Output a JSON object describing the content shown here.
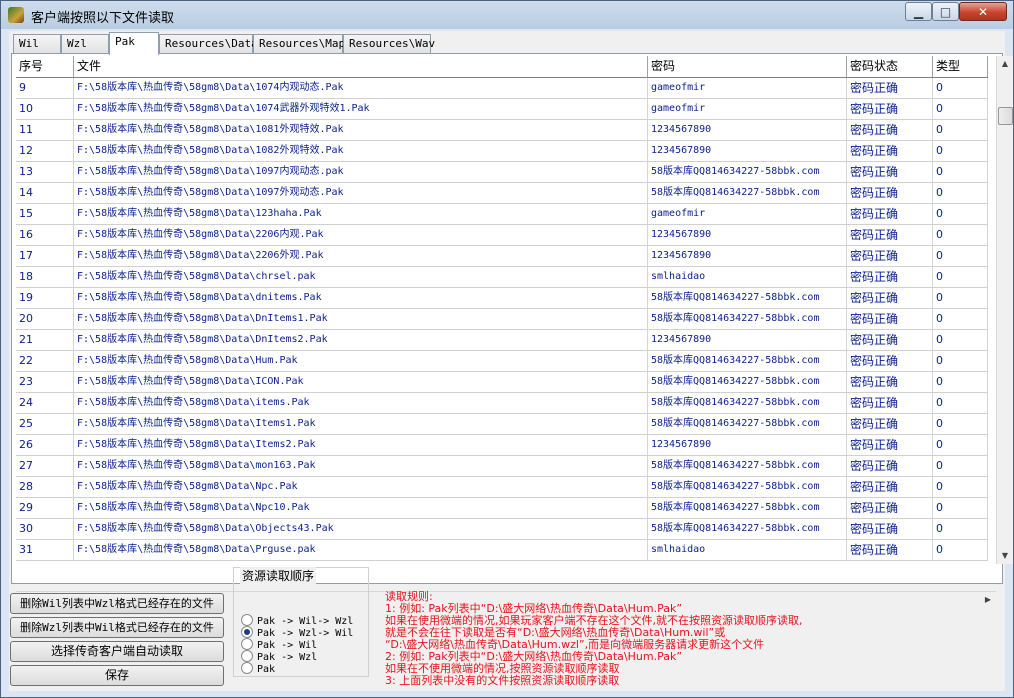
{
  "window": {
    "title": "客户端按照以下文件读取",
    "minimize_symbol": "▁",
    "maximize_symbol": "□",
    "close_symbol": "✕"
  },
  "tabs": [
    {
      "label": "Wil"
    },
    {
      "label": "Wzl"
    },
    {
      "label": "Pak"
    },
    {
      "label": "Resources\\Data"
    },
    {
      "label": "Resources\\Map"
    },
    {
      "label": "Resources\\Wav"
    }
  ],
  "active_tab": "Pak",
  "table": {
    "headers": {
      "index": "序号",
      "file": "文件",
      "password": "密码",
      "password_status": "密码状态",
      "type": "类型"
    },
    "rows": [
      {
        "index": "9",
        "file": "F:\\58版本库\\热血传奇\\58gm8\\Data\\1074内观动态.Pak",
        "password": "gameofmir",
        "status": "密码正确",
        "type": "0"
      },
      {
        "index": "10",
        "file": "F:\\58版本库\\热血传奇\\58gm8\\Data\\1074武器外观特效1.Pak",
        "password": "gameofmir",
        "status": "密码正确",
        "type": "0"
      },
      {
        "index": "11",
        "file": "F:\\58版本库\\热血传奇\\58gm8\\Data\\1081外观特效.Pak",
        "password": "1234567890",
        "status": "密码正确",
        "type": "0"
      },
      {
        "index": "12",
        "file": "F:\\58版本库\\热血传奇\\58gm8\\Data\\1082外观特效.Pak",
        "password": "1234567890",
        "status": "密码正确",
        "type": "0"
      },
      {
        "index": "13",
        "file": "F:\\58版本库\\热血传奇\\58gm8\\Data\\1097内观动态.pak",
        "password": "58版本库QQ814634227-58bbk.com",
        "status": "密码正确",
        "type": "0"
      },
      {
        "index": "14",
        "file": "F:\\58版本库\\热血传奇\\58gm8\\Data\\1097外观动态.Pak",
        "password": "58版本库QQ814634227-58bbk.com",
        "status": "密码正确",
        "type": "0"
      },
      {
        "index": "15",
        "file": "F:\\58版本库\\热血传奇\\58gm8\\Data\\123haha.Pak",
        "password": "gameofmir",
        "status": "密码正确",
        "type": "0"
      },
      {
        "index": "16",
        "file": "F:\\58版本库\\热血传奇\\58gm8\\Data\\2206内观.Pak",
        "password": "1234567890",
        "status": "密码正确",
        "type": "0"
      },
      {
        "index": "17",
        "file": "F:\\58版本库\\热血传奇\\58gm8\\Data\\2206外观.Pak",
        "password": "1234567890",
        "status": "密码正确",
        "type": "0"
      },
      {
        "index": "18",
        "file": "F:\\58版本库\\热血传奇\\58gm8\\Data\\chrsel.pak",
        "password": "smlhaidao",
        "status": "密码正确",
        "type": "0"
      },
      {
        "index": "19",
        "file": "F:\\58版本库\\热血传奇\\58gm8\\Data\\dnitems.Pak",
        "password": "58版本库QQ814634227-58bbk.com",
        "status": "密码正确",
        "type": "0"
      },
      {
        "index": "20",
        "file": "F:\\58版本库\\热血传奇\\58gm8\\Data\\DnItems1.Pak",
        "password": "58版本库QQ814634227-58bbk.com",
        "status": "密码正确",
        "type": "0"
      },
      {
        "index": "21",
        "file": "F:\\58版本库\\热血传奇\\58gm8\\Data\\DnItems2.Pak",
        "password": "1234567890",
        "status": "密码正确",
        "type": "0"
      },
      {
        "index": "22",
        "file": "F:\\58版本库\\热血传奇\\58gm8\\Data\\Hum.Pak",
        "password": "58版本库QQ814634227-58bbk.com",
        "status": "密码正确",
        "type": "0"
      },
      {
        "index": "23",
        "file": "F:\\58版本库\\热血传奇\\58gm8\\Data\\ICON.Pak",
        "password": "58版本库QQ814634227-58bbk.com",
        "status": "密码正确",
        "type": "0"
      },
      {
        "index": "24",
        "file": "F:\\58版本库\\热血传奇\\58gm8\\Data\\items.Pak",
        "password": "58版本库QQ814634227-58bbk.com",
        "status": "密码正确",
        "type": "0"
      },
      {
        "index": "25",
        "file": "F:\\58版本库\\热血传奇\\58gm8\\Data\\Items1.Pak",
        "password": "58版本库QQ814634227-58bbk.com",
        "status": "密码正确",
        "type": "0"
      },
      {
        "index": "26",
        "file": "F:\\58版本库\\热血传奇\\58gm8\\Data\\Items2.Pak",
        "password": "1234567890",
        "status": "密码正确",
        "type": "0"
      },
      {
        "index": "27",
        "file": "F:\\58版本库\\热血传奇\\58gm8\\Data\\mon163.Pak",
        "password": "58版本库QQ814634227-58bbk.com",
        "status": "密码正确",
        "type": "0"
      },
      {
        "index": "28",
        "file": "F:\\58版本库\\热血传奇\\58gm8\\Data\\Npc.Pak",
        "password": "58版本库QQ814634227-58bbk.com",
        "status": "密码正确",
        "type": "0"
      },
      {
        "index": "29",
        "file": "F:\\58版本库\\热血传奇\\58gm8\\Data\\Npc10.Pak",
        "password": "58版本库QQ814634227-58bbk.com",
        "status": "密码正确",
        "type": "0"
      },
      {
        "index": "30",
        "file": "F:\\58版本库\\热血传奇\\58gm8\\Data\\Objects43.Pak",
        "password": "58版本库QQ814634227-58bbk.com",
        "status": "密码正确",
        "type": "0"
      },
      {
        "index": "31",
        "file": "F:\\58版本库\\热血传奇\\58gm8\\Data\\Prguse.pak",
        "password": "smlhaidao",
        "status": "密码正确",
        "type": "0"
      }
    ]
  },
  "buttons": {
    "delete_wil": "删除Wil列表中Wzl格式已经存在的文件",
    "delete_wzl": "删除Wzl列表中Wil格式已经存在的文件",
    "auto_read": "选择传奇客户端自动读取",
    "save": "保存"
  },
  "read_order": {
    "title": "资源读取顺序",
    "options": [
      {
        "label": "Pak -> Wil-> Wzl",
        "selected": false
      },
      {
        "label": "Pak -> Wzl-> Wil",
        "selected": true
      },
      {
        "label": "Pak -> Wil",
        "selected": false
      },
      {
        "label": "Pak -> Wzl",
        "selected": false
      },
      {
        "label": "Pak",
        "selected": false
      }
    ]
  },
  "rules": {
    "lines": [
      "读取规则:",
      "1: 例如: Pak列表中“D:\\盛大网络\\热血传奇\\Data\\Hum.Pak”",
      "    如果在使用微端的情况,如果玩家客户端不存在这个文件,就不在按照资源读取顺序读取,",
      "    就是不会在往下读取是否有“D:\\盛大网络\\热血传奇\\Data\\Hum.wil”或",
      "    “D:\\盛大网络\\热血传奇\\Data\\Hum.wzl”,而是向微端服务器请求更新这个文件",
      "2: 例如: Pak列表中“D:\\盛大网络\\热血传奇\\Data\\Hum.Pak”",
      "    如果在不使用微端的情况,按照资源读取顺序读取",
      "3: 上面列表中没有的文件按照资源读取顺序读取"
    ]
  },
  "colors": {
    "row_text": "#0a1f8c",
    "rules_text": "#e8121d",
    "radio_selected": "#1a3d86"
  }
}
